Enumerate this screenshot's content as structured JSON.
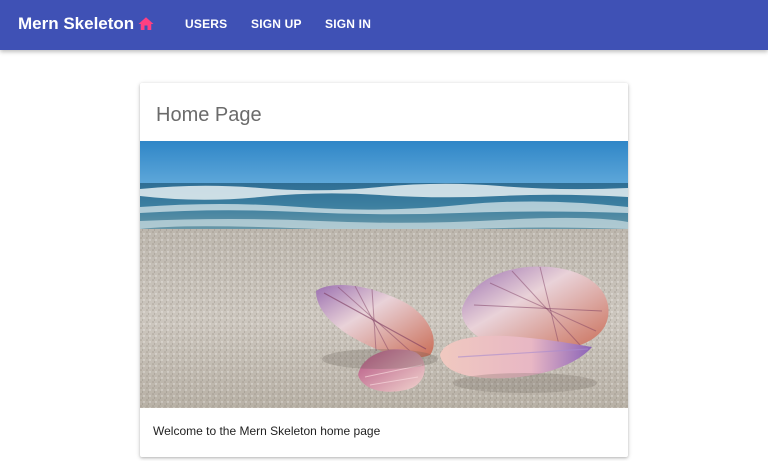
{
  "appbar": {
    "brand": "Mern Skeleton",
    "home_icon": "home-icon",
    "nav": [
      {
        "label": "USERS"
      },
      {
        "label": "SIGN UP"
      },
      {
        "label": "SIGN IN"
      }
    ],
    "background_color": "#3f51b5",
    "home_icon_color": "#ff4081"
  },
  "card": {
    "title": "Home Page",
    "image_alt": "seashells on beach",
    "text": "Welcome to the Mern Skeleton home page"
  }
}
